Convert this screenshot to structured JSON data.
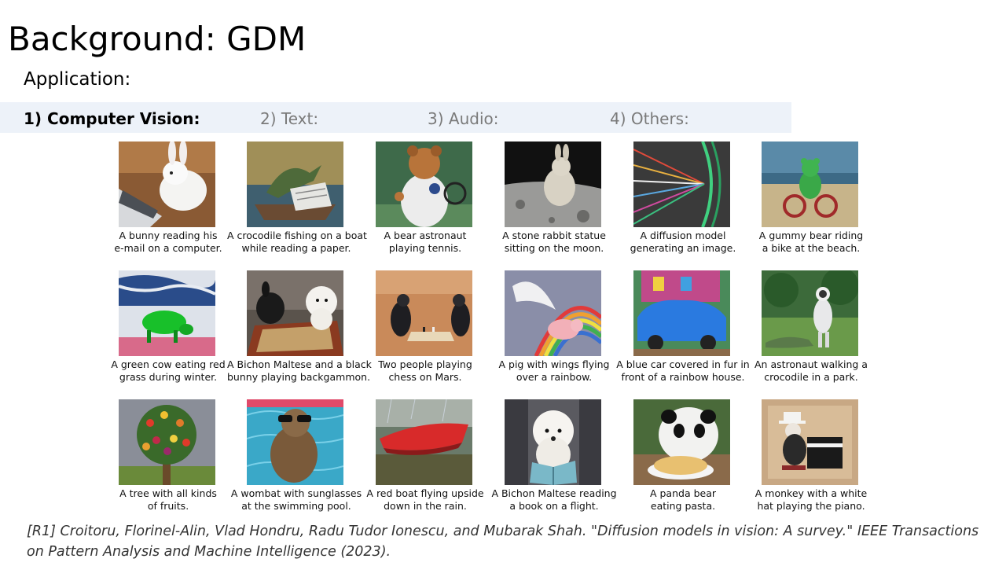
{
  "slide": {
    "title": "Background: GDM",
    "subtitle": "Application:"
  },
  "categories": [
    {
      "label": "1) Computer Vision:"
    },
    {
      "label": "2) Text:"
    },
    {
      "label": "3) Audio:"
    },
    {
      "label": "4) Others:"
    }
  ],
  "gallery": [
    {
      "line1": "A bunny reading his",
      "line2": "e-mail on a computer.",
      "icon": "bunny-laptop-image"
    },
    {
      "line1": "A crocodile fishing on a boat",
      "line2": "while reading a paper.",
      "icon": "crocodile-boat-image"
    },
    {
      "line1": "A bear astronaut",
      "line2": "playing tennis.",
      "icon": "bear-astronaut-image"
    },
    {
      "line1": "A stone rabbit statue",
      "line2": "sitting on the moon.",
      "icon": "rabbit-statue-moon-image"
    },
    {
      "line1": "A diffusion model",
      "line2": "generating an image.",
      "icon": "diffusion-model-image"
    },
    {
      "line1": "A gummy bear riding",
      "line2": "a bike at the beach.",
      "icon": "gummy-bear-bike-image"
    },
    {
      "line1": "A green cow eating red",
      "line2": "grass during winter.",
      "icon": "green-cow-image"
    },
    {
      "line1": "A Bichon Maltese and a black",
      "line2": "bunny playing backgammon.",
      "icon": "bichon-backgammon-image"
    },
    {
      "line1": "Two people playing",
      "line2": "chess on Mars.",
      "icon": "chess-mars-image"
    },
    {
      "line1": "A pig with wings flying",
      "line2": "over a rainbow.",
      "icon": "flying-pig-image"
    },
    {
      "line1": "A blue car covered in fur in",
      "line2": "front of a rainbow house.",
      "icon": "furry-car-image"
    },
    {
      "line1": "An astronaut walking a",
      "line2": "crocodile in a park.",
      "icon": "astronaut-crocodile-image"
    },
    {
      "line1": "A tree with all kinds",
      "line2": "of fruits.",
      "icon": "fruit-tree-image"
    },
    {
      "line1": "A wombat with sunglasses",
      "line2": "at the swimming pool.",
      "icon": "wombat-pool-image"
    },
    {
      "line1": "A red boat flying upside",
      "line2": "down in the rain.",
      "icon": "red-boat-image"
    },
    {
      "line1": "A Bichon Maltese reading",
      "line2": "a book on a flight.",
      "icon": "bichon-reading-image"
    },
    {
      "line1": "A panda bear",
      "line2": "eating pasta.",
      "icon": "panda-pasta-image"
    },
    {
      "line1": "A monkey with a white",
      "line2": "hat playing the piano.",
      "icon": "monkey-piano-image"
    }
  ],
  "reference": {
    "line1": "[R1] Croitoru, Florinel-Alin, Vlad Hondru, Radu Tudor Ionescu, and Mubarak Shah. \"Diffusion models in vision: A survey.\" IEEE Transactions",
    "line2": "on Pattern Analysis and Machine Intelligence (2023)."
  }
}
